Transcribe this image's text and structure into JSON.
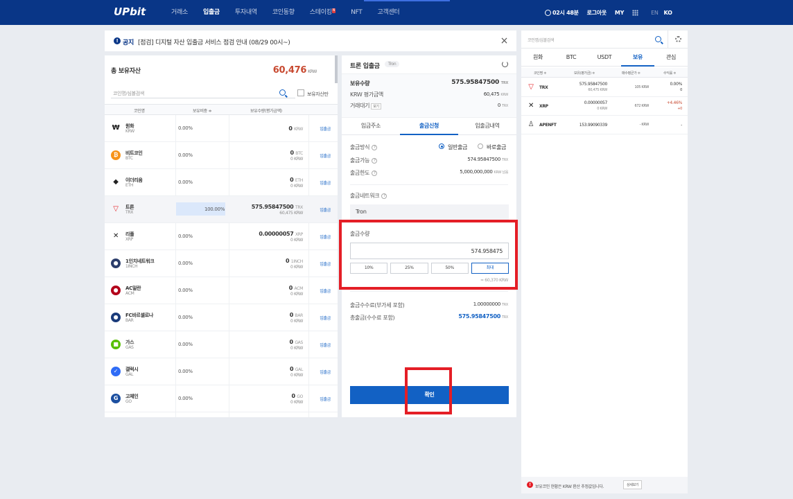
{
  "nav": {
    "logo": "UPbit",
    "menu": [
      "거래소",
      "입출금",
      "투자내역",
      "코인동향",
      "스테이킹",
      "NFT",
      "고객센터"
    ],
    "new_badge": "N",
    "timer": "02시 48분",
    "logout": "로그아웃",
    "my": "MY",
    "lang_en": "EN",
    "lang_ko": "KO"
  },
  "notice": {
    "tag": "공지",
    "text": "[점검] 디지털 자산 입출금 서비스 점검 안내 (08/29 00시~)",
    "close": "×"
  },
  "assets": {
    "title": "총 보유자산",
    "total": "60,476",
    "total_unit": "KRW",
    "search_placeholder": "코인명/심볼검색",
    "only_held": "보유자산만",
    "cols": [
      "코인명",
      "보유비중 ≑",
      "보유수량(평가금액)"
    ],
    "rows": [
      {
        "name": "원화",
        "sym": "KRW",
        "pct": "0.00%",
        "amt": "0",
        "unit": "KRW",
        "krw": "",
        "dep": "입출금",
        "icon": "₩",
        "color": "#fff"
      },
      {
        "name": "비트코인",
        "sym": "BTC",
        "pct": "0.00%",
        "amt": "0",
        "unit": "BTC",
        "krw": "0 KRW",
        "dep": "입출금",
        "icon": "₿",
        "color": "#f7931a"
      },
      {
        "name": "이더리움",
        "sym": "ETH",
        "pct": "0.00%",
        "amt": "0",
        "unit": "ETH",
        "krw": "0 KRW",
        "dep": "입출금",
        "icon": "◆",
        "color": "#fff"
      },
      {
        "name": "트론",
        "sym": "TRX",
        "pct": "100.00%",
        "amt": "575.95847500",
        "unit": "TRX",
        "krw": "60,475 KRW",
        "dep": "입출금",
        "icon": "▽",
        "color": "#fff"
      },
      {
        "name": "리플",
        "sym": "XRP",
        "pct": "0.00%",
        "amt": "0.00000057",
        "unit": "XRP",
        "krw": "0 KRW",
        "dep": "입출금",
        "icon": "✕",
        "color": "#fff"
      },
      {
        "name": "1인치네트워크",
        "sym": "1INCH",
        "pct": "0.00%",
        "amt": "0",
        "unit": "1INCH",
        "krw": "0 KRW",
        "dep": "입출금",
        "icon": "●",
        "color": "#2b3d6b"
      },
      {
        "name": "AC밀란",
        "sym": "ACM",
        "pct": "0.00%",
        "amt": "0",
        "unit": "ACM",
        "krw": "0 KRW",
        "dep": "입출금",
        "icon": "●",
        "color": "#b3001b"
      },
      {
        "name": "FC바르셀로나",
        "sym": "BAR",
        "pct": "0.00%",
        "amt": "0",
        "unit": "BAR",
        "krw": "0 KRW",
        "dep": "입출금",
        "icon": "●",
        "color": "#1a3b7a"
      },
      {
        "name": "가스",
        "sym": "GAS",
        "pct": "0.00%",
        "amt": "0",
        "unit": "GAS",
        "krw": "0 KRW",
        "dep": "입출금",
        "icon": "■",
        "color": "#58bf00"
      },
      {
        "name": "갤럭시",
        "sym": "GAL",
        "pct": "0.00%",
        "amt": "0",
        "unit": "GAL",
        "krw": "0 KRW",
        "dep": "입출금",
        "icon": "✓",
        "color": "#2f6cf6"
      },
      {
        "name": "고체인",
        "sym": "GO",
        "pct": "0.00%",
        "amt": "0",
        "unit": "GO",
        "krw": "0 KRW",
        "dep": "입출금",
        "icon": "G",
        "color": "#1c4fa0"
      }
    ]
  },
  "withdraw": {
    "title": "트론 입출금",
    "tag": "Tron",
    "held_label": "보유수량",
    "held": "575.95847500",
    "held_unit": "TRX",
    "krw_label": "KRW 평가금액",
    "krw": "60,475",
    "krw_unit": "KRW",
    "pending_label": "거래대기",
    "pending_btn": "보기",
    "pending": "0",
    "pending_unit": "TRX",
    "tabs": [
      "입금주소",
      "출금신청",
      "입출금내역"
    ],
    "method_label": "출금방식",
    "method_normal": "일반출금",
    "method_instant": "바로출금",
    "avail_label": "출금가능",
    "avail": "574.95847500",
    "avail_unit": "TRX",
    "limit_label": "출금한도",
    "limit": "5,000,000,000",
    "limit_unit": "KRW 남음",
    "network_label": "출금네트워크",
    "network": "Tron",
    "amount_label": "출금수량",
    "amount": "574.958475",
    "pct_btns": [
      "10%",
      "25%",
      "50%",
      "최대"
    ],
    "approx": "≈ 60,370 KRW",
    "fee_label": "출금수수료(부가세 포함)",
    "fee": "1.00000000",
    "fee_unit": "TRX",
    "total_label": "총출금(수수료 포함)",
    "total": "575.95847500",
    "total_unit": "TRX",
    "confirm": "확인"
  },
  "market": {
    "search_placeholder": "코인명/심볼검색",
    "tabs": [
      "원화",
      "BTC",
      "USDT",
      "보유",
      "관심"
    ],
    "cols": [
      "코인명 ≑",
      "보유(평가금) ≑",
      "매수평균가 ≑",
      "수익률 ≑"
    ],
    "rows": [
      {
        "sym": "TRX",
        "amt": "575.95847500",
        "krw": "60,475 KRW",
        "avg": "105 KRW",
        "pct": "0.00%",
        "pct2": "0",
        "icon": "▽"
      },
      {
        "sym": "XRP",
        "amt": "0.00000057",
        "krw": "0 KRW",
        "avg": "672 KRW",
        "pct": "+4.46%",
        "pct2": "+0",
        "icon": "✕"
      },
      {
        "sym": "APENFT",
        "amt": "153.99090339",
        "krw": "",
        "avg": "- KRW",
        "pct": "-",
        "pct2": "",
        "icon": "♙"
      }
    ],
    "footer": "보유코인 현황은 KRW 환산 추정값입니다.",
    "footer_btn": "상세보기"
  },
  "colors": {
    "nav": "#093687",
    "accent": "#1261c4",
    "up": "#c84a31",
    "highlight": "#e41e26"
  }
}
